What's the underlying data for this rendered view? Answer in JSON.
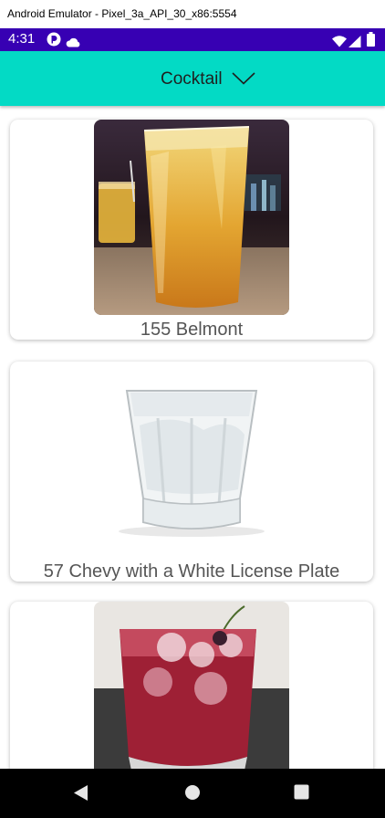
{
  "window": {
    "title": "Android Emulator - Pixel_3a_API_30_x86:5554"
  },
  "status_bar": {
    "time": "4:31",
    "icons": [
      "app-notification-icon",
      "cloud-icon",
      "wifi-icon",
      "signal-icon",
      "battery-icon"
    ]
  },
  "app_bar": {
    "picker_label": "Cocktail",
    "picker_icon": "chevron-down-icon"
  },
  "cocktails": [
    {
      "name": "155 Belmont"
    },
    {
      "name": "57 Chevy with a White License Plate"
    },
    {
      "name": ""
    }
  ],
  "nav_bar": {
    "buttons": [
      "back-icon",
      "home-icon",
      "recents-icon"
    ]
  },
  "colors": {
    "status_bar": "#3700b3",
    "app_bar": "#03dac5",
    "nav_bar": "#000000"
  }
}
